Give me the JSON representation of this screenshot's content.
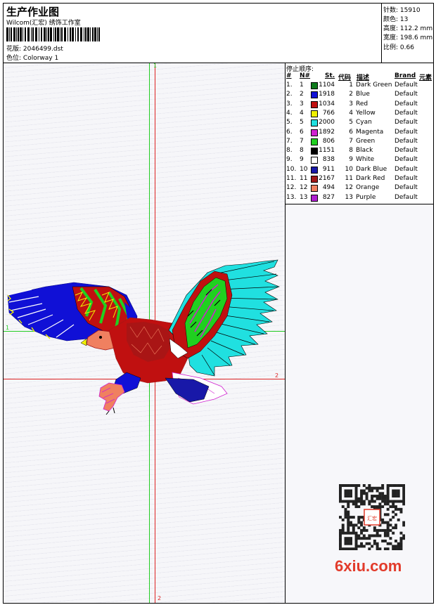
{
  "header": {
    "title": "生产作业图",
    "subtitle": "Wilcom(汇宏) 绣饰工作室",
    "design_label": "花版:",
    "design_value": "2046499.dst",
    "colorway_label": "色位:",
    "colorway_value": "Colorway 1"
  },
  "stats": {
    "stitches_label": "针数:",
    "stitches_value": "15910",
    "colors_label": "颜色:",
    "colors_value": "13",
    "height_label": "高度:",
    "height_value": "112.2 mm",
    "width_label": "宽度:",
    "width_value": "198.6 mm",
    "scale_label": "比例:",
    "scale_value": "0.66"
  },
  "stop_sequence": {
    "title": "停止顺序:",
    "headers": {
      "index": "#",
      "number": "N#",
      "stitches": "St.",
      "code": "代码",
      "description": "描述",
      "brand": "Brand",
      "element": "元素"
    },
    "rows": [
      {
        "index": "1.",
        "number": "1",
        "stitches": "1104",
        "code": "1",
        "description": "Dark Green",
        "brand": "Default",
        "color": "#0e7b1c"
      },
      {
        "index": "2.",
        "number": "2",
        "stitches": "1918",
        "code": "2",
        "description": "Blue",
        "brand": "Default",
        "color": "#1010d6"
      },
      {
        "index": "3.",
        "number": "3",
        "stitches": "1034",
        "code": "3",
        "description": "Red",
        "brand": "Default",
        "color": "#c01010"
      },
      {
        "index": "4.",
        "number": "4",
        "stitches": "766",
        "code": "4",
        "description": "Yellow",
        "brand": "Default",
        "color": "#f0f000"
      },
      {
        "index": "5.",
        "number": "5",
        "stitches": "2000",
        "code": "5",
        "description": "Cyan",
        "brand": "Default",
        "color": "#20e0e0"
      },
      {
        "index": "6.",
        "number": "6",
        "stitches": "1892",
        "code": "6",
        "description": "Magenta",
        "brand": "Default",
        "color": "#d020d0"
      },
      {
        "index": "7.",
        "number": "7",
        "stitches": "806",
        "code": "7",
        "description": "Green",
        "brand": "Default",
        "color": "#20d020"
      },
      {
        "index": "8.",
        "number": "8",
        "stitches": "1151",
        "code": "8",
        "description": "Black",
        "brand": "Default",
        "color": "#000000"
      },
      {
        "index": "9.",
        "number": "9",
        "stitches": "838",
        "code": "9",
        "description": "White",
        "brand": "Default",
        "color": "#ffffff"
      },
      {
        "index": "10.",
        "number": "10",
        "stitches": "911",
        "code": "10",
        "description": "Dark Blue",
        "brand": "Default",
        "color": "#1818a8"
      },
      {
        "index": "11.",
        "number": "11",
        "stitches": "2167",
        "code": "11",
        "description": "Dark Red",
        "brand": "Default",
        "color": "#a01818"
      },
      {
        "index": "12.",
        "number": "12",
        "stitches": "494",
        "code": "12",
        "description": "Orange",
        "brand": "Default",
        "color": "#f08060"
      },
      {
        "index": "13.",
        "number": "13",
        "stitches": "827",
        "code": "13",
        "description": "Purple",
        "brand": "Default",
        "color": "#b020d0"
      }
    ]
  },
  "guides": {
    "vertical_top_label": "1",
    "vertical_bottom_label": "2",
    "horizontal_left_label": "1",
    "horizontal_right_label": "2"
  },
  "watermark": {
    "text": "6xiu.com",
    "stamp_text": "汇宏刺绣"
  },
  "colors": {
    "guide_green": "#22cc22",
    "guide_red": "#dd2222",
    "watermark_red": "#e23b2b"
  }
}
